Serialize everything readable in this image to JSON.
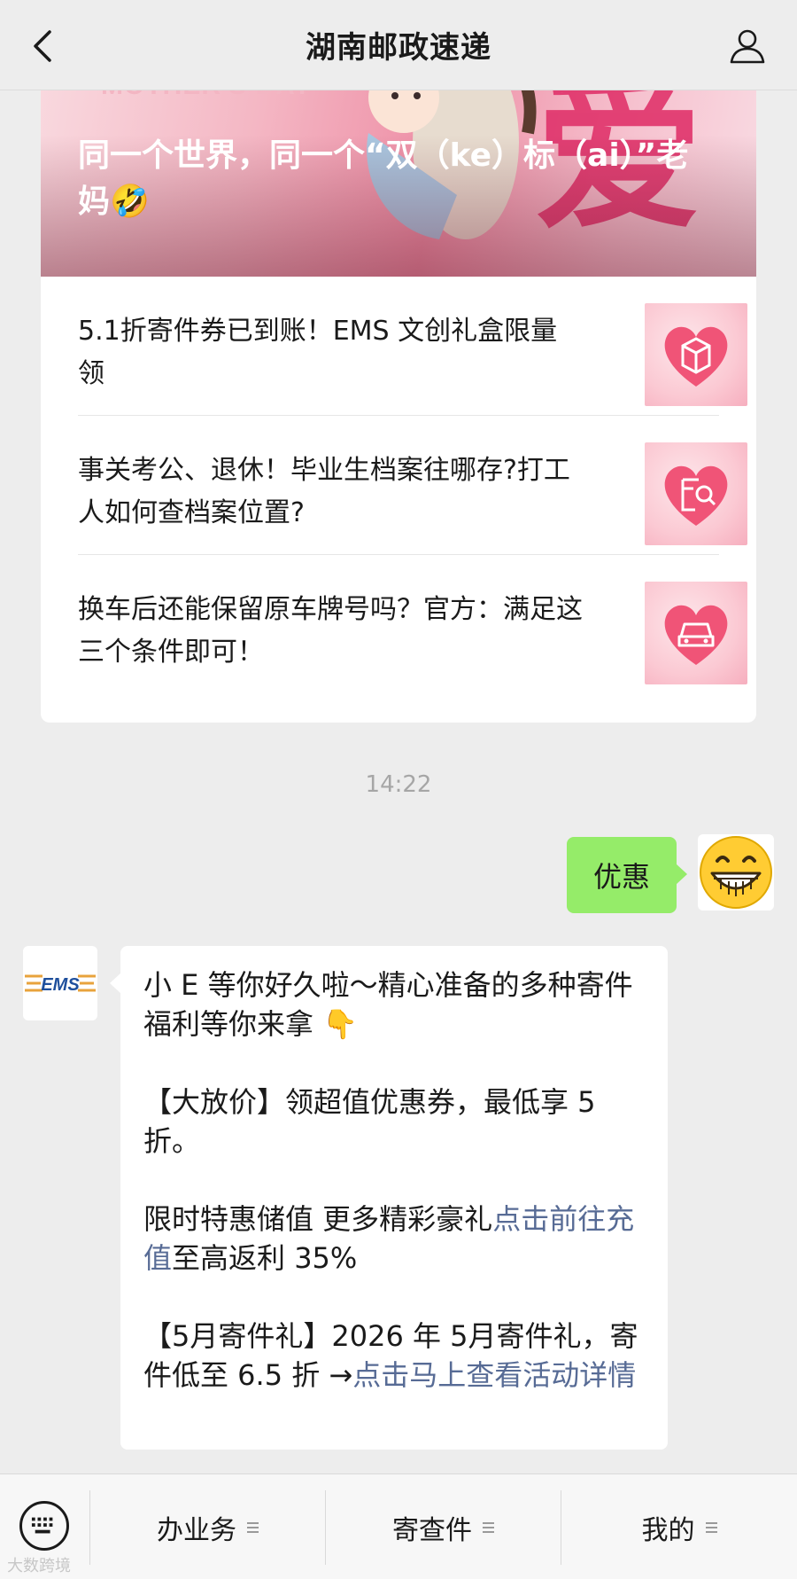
{
  "navbar": {
    "title": "湖南邮政速递",
    "back_icon": "chevron-left-icon",
    "profile_icon": "user-icon"
  },
  "article": {
    "cover_label": "MOTHER'S DAY",
    "cover_title": "同一个世界，同一个“双（ke）标（ai）”老妈🤣",
    "items": [
      {
        "title": "5.1折寄件券已到账！EMS 文创礼盒限量领",
        "thumb_icon": "gift-box-icon"
      },
      {
        "title": "事关考公、退休！毕业生档案往哪存?打工人如何查档案位置?",
        "thumb_icon": "document-search-icon"
      },
      {
        "title": "换车后还能保留原车牌号吗？官方：满足这三个条件即可！",
        "thumb_icon": "car-icon"
      }
    ]
  },
  "chat": {
    "timestamp": "14:22",
    "outgoing": {
      "text": "优惠",
      "avatar_icon": "grinning-emoji-avatar"
    },
    "incoming": {
      "avatar_label": "EMS",
      "p1": "小 E 等你好久啦～精心准备的多种寄件福利等你来拿 👇",
      "p2": "【大放价】领超值优惠券，最低享 5 折。",
      "p3_pre": "限时特惠储值 更多精彩豪礼",
      "p3_link": "点击前往充值",
      "p3_post": "至高返利 35%",
      "p4_pre": "【5月寄件礼】2026 年 5月寄件礼，寄件低至 6.5 折 →",
      "p4_link": "点击马上查看活动详情"
    }
  },
  "bottom_menu": {
    "keyboard_icon": "keyboard-icon",
    "items": [
      "办业务",
      "寄查件",
      "我的"
    ]
  },
  "watermark": "大数跨境",
  "colors": {
    "background": "#ededed",
    "outgoing_bubble": "#95ec69",
    "link": "#576b95",
    "ems_orange": "#e8a33c",
    "ems_blue": "#1e4f9c"
  }
}
